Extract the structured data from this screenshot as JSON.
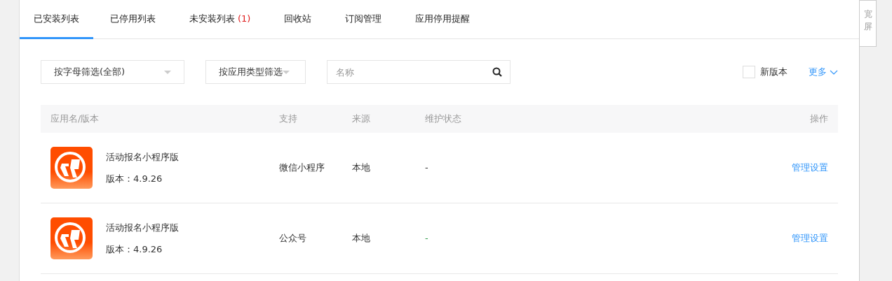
{
  "tabs": [
    {
      "label": "已安装列表",
      "selected": true
    },
    {
      "label": "已停用列表",
      "selected": false
    },
    {
      "label": "未安装列表",
      "count": "(1)",
      "selected": false
    },
    {
      "label": "回收站",
      "selected": false
    },
    {
      "label": "订阅管理",
      "selected": false
    },
    {
      "label": "应用停用提醒",
      "selected": false
    }
  ],
  "filters": {
    "letter_filter": "按字母筛选(全部)",
    "type_filter": "按应用类型筛选",
    "search": {
      "placeholder": "名称"
    },
    "new_version": {
      "label": "新版本",
      "checked": false
    },
    "more": "更多"
  },
  "wide_screen": "宽屏",
  "table": {
    "columns": [
      "应用名/版本",
      "支持",
      "来源",
      "维护状态",
      "操作"
    ],
    "rows": [
      {
        "name": "活动报名小程序版",
        "version": "版本：4.9.26",
        "support": "微信小程序",
        "source": "本地",
        "status": {
          "text": "-",
          "color": "#333333"
        },
        "action": "管理设置"
      },
      {
        "name": "活动报名小程序版",
        "version": "版本：4.9.26",
        "support": "公众号",
        "source": "本地",
        "status": {
          "text": "-",
          "color": "#2e9a4a"
        },
        "action": "管理设置"
      }
    ]
  }
}
